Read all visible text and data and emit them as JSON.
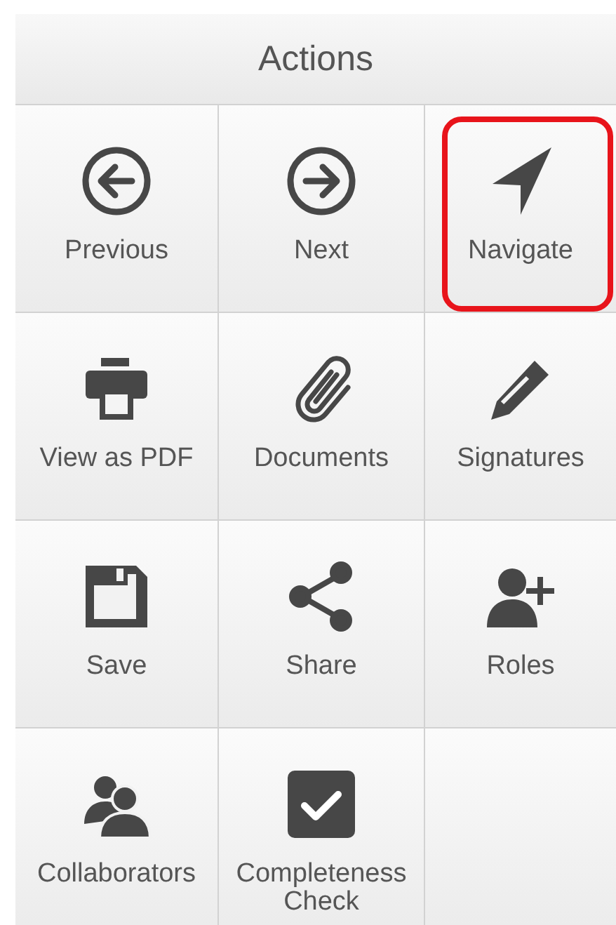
{
  "panel": {
    "title": "Actions"
  },
  "actions": [
    {
      "label": "Previous",
      "highlighted": false
    },
    {
      "label": "Next",
      "highlighted": false
    },
    {
      "label": "Navigate",
      "highlighted": true
    },
    {
      "label": "View as PDF",
      "highlighted": false
    },
    {
      "label": "Documents",
      "highlighted": false
    },
    {
      "label": "Signatures",
      "highlighted": false
    },
    {
      "label": "Save",
      "highlighted": false
    },
    {
      "label": "Share",
      "highlighted": false
    },
    {
      "label": "Roles",
      "highlighted": false
    },
    {
      "label": "Collaborators",
      "highlighted": false
    },
    {
      "label": "Completeness Check",
      "highlighted": false
    }
  ]
}
